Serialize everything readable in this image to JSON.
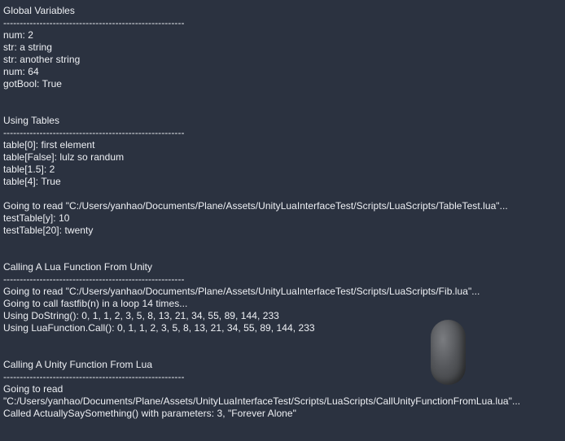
{
  "console": {
    "lines": [
      "Global Variables",
      "-------------------------------------------------------",
      "num: 2",
      "str: a string",
      "str: another string",
      "num: 64",
      "gotBool: True",
      "",
      "",
      "Using Tables",
      "-------------------------------------------------------",
      "table[0]: first element",
      "table[False]: lulz so randum",
      "table[1.5]: 2",
      "table[4]: True",
      "",
      "Going to read \"C:/Users/yanhao/Documents/Plane/Assets/UnityLuaInterfaceTest/Scripts/LuaScripts/TableTest.lua\"...",
      "testTable[y]: 10",
      "testTable[20]: twenty",
      "",
      "",
      "Calling A Lua Function From Unity",
      "-------------------------------------------------------",
      "Going to read \"C:/Users/yanhao/Documents/Plane/Assets/UnityLuaInterfaceTest/Scripts/LuaScripts/Fib.lua\"...",
      "Going to call fastfib(n) in a loop 14 times...",
      "Using DoString(): 0, 1, 1, 2, 3, 5, 8, 13, 21, 34, 55, 89, 144, 233",
      "Using LuaFunction.Call(): 0, 1, 1, 2, 3, 5, 8, 13, 21, 34, 55, 89, 144, 233",
      "",
      "",
      "Calling A Unity Function From Lua",
      "-------------------------------------------------------",
      "Going to read",
      "\"C:/Users/yanhao/Documents/Plane/Assets/UnityLuaInterfaceTest/Scripts/LuaScripts/CallUnityFunctionFromLua.lua\"...",
      "Called ActuallySaySomething() with parameters: 3, \"Forever Alone\""
    ]
  },
  "scene": {
    "object": "capsule",
    "background_color": "#2b3240",
    "text_color": "#eef0f4"
  }
}
